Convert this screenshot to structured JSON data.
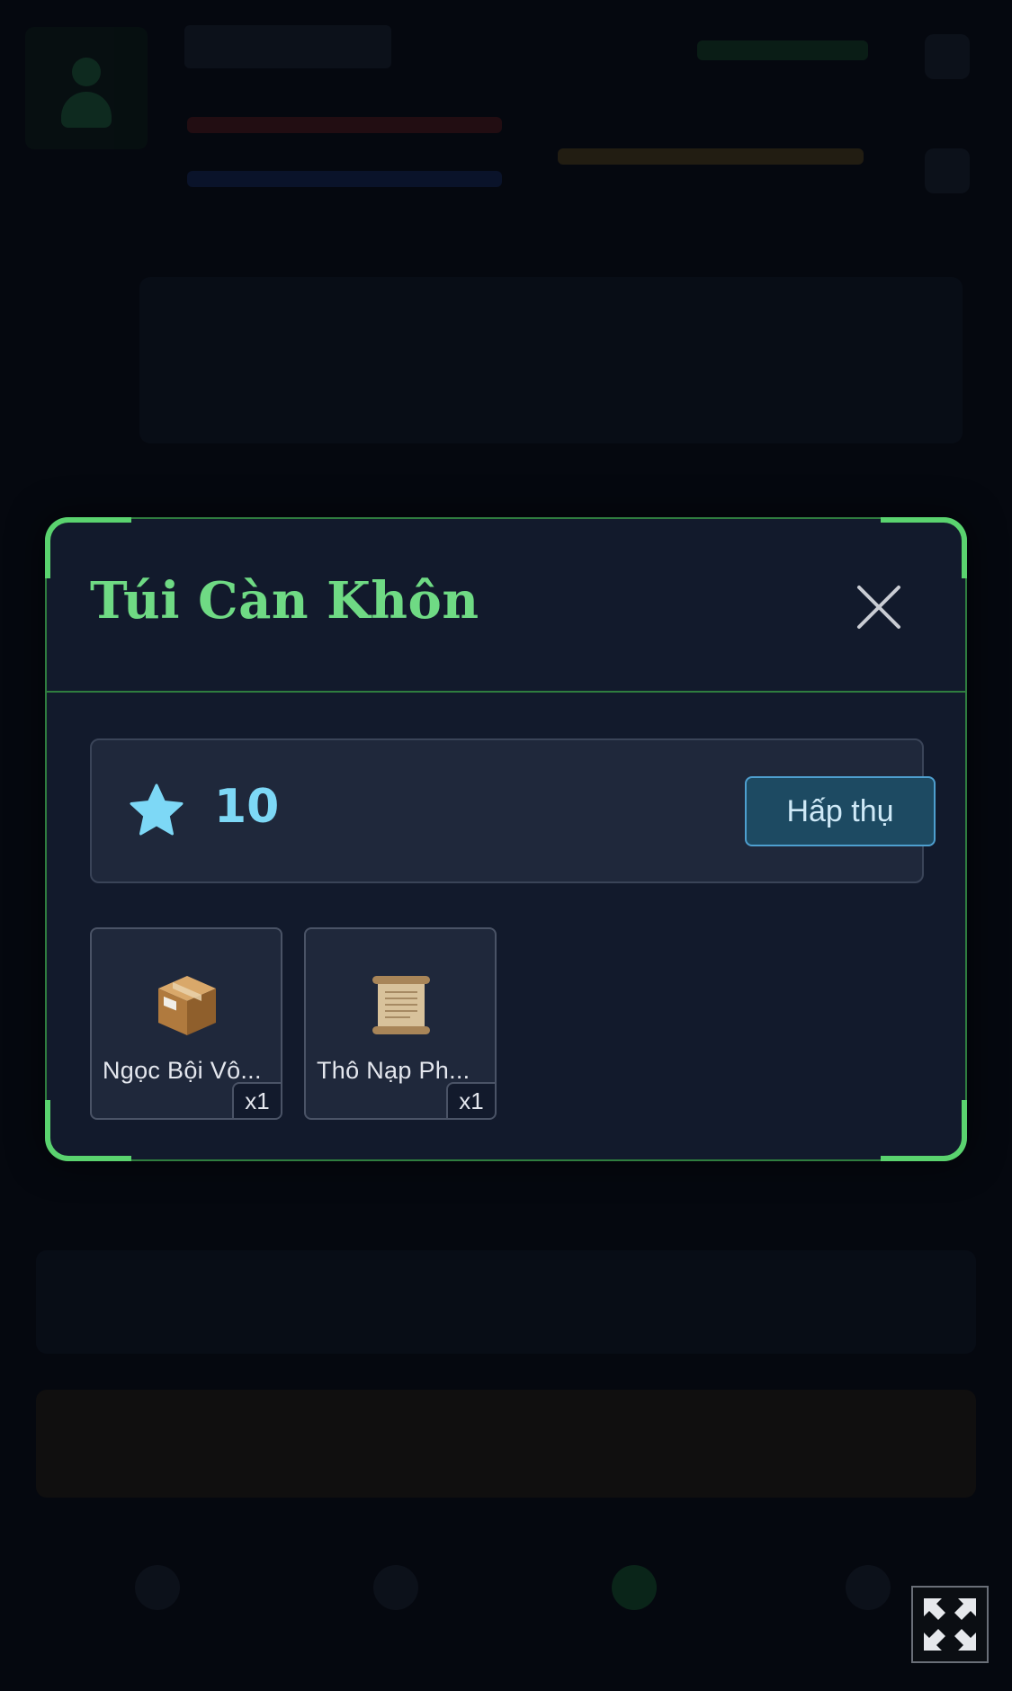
{
  "colors": {
    "accent": "#6fda84",
    "modal_border": "#5ad36f",
    "essence": "#7dd8f6",
    "absorb_button_bg": "#1d4a62",
    "panel_bg": "#1f283b",
    "modal_bg": "#121a2c"
  },
  "modal": {
    "title": "Túi Càn Khôn",
    "close_icon": "close-icon"
  },
  "essence": {
    "icon": "star-icon",
    "value": "10",
    "absorb_label": "Hấp thụ"
  },
  "items": [
    {
      "name": "Ngọc Bội Vô...",
      "quantity": "x1",
      "icon": "package-box-icon"
    },
    {
      "name": "Thô Nạp Ph...",
      "quantity": "x1",
      "icon": "scroll-icon"
    }
  ],
  "overlay": {
    "fullscreen_icon": "fullscreen-toggle-icon"
  }
}
